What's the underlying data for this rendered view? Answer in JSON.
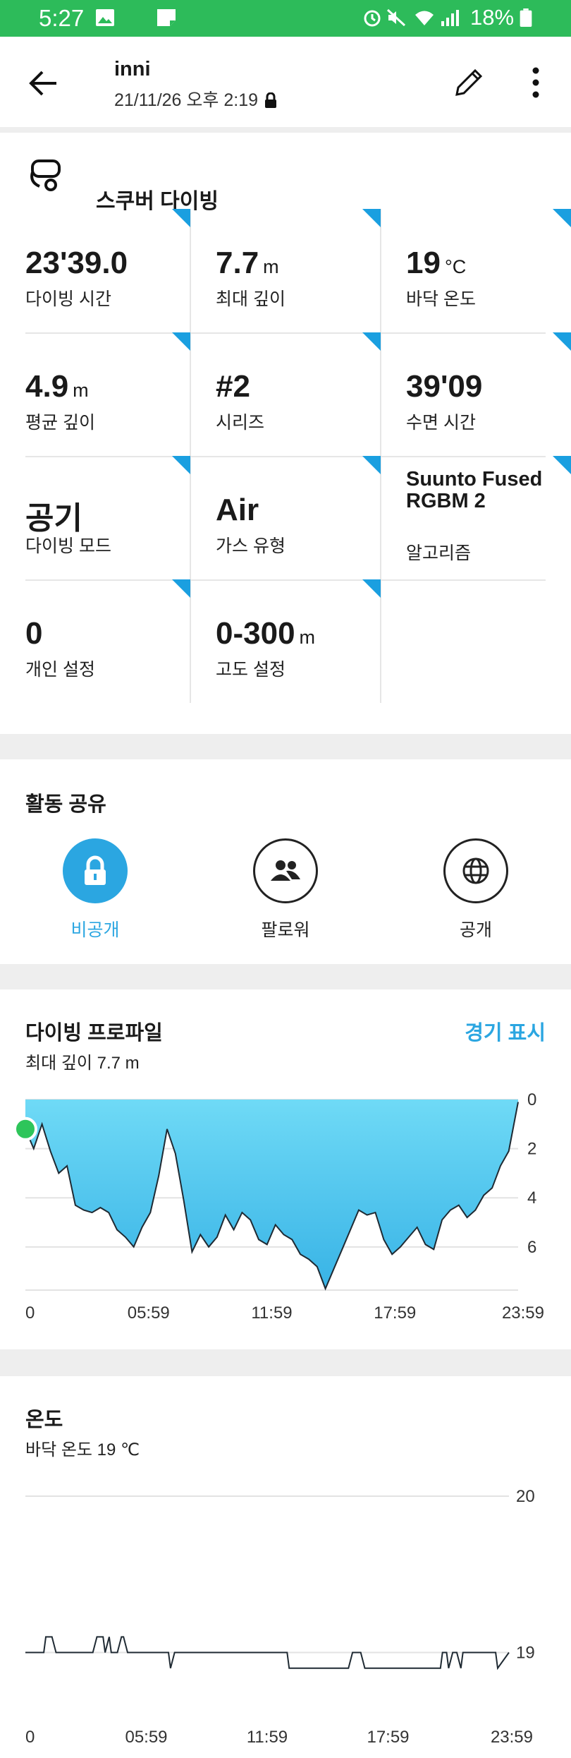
{
  "status_bar": {
    "time": "5:27",
    "battery": "18%"
  },
  "app_bar": {
    "title": "inni",
    "subtitle": "21/11/26 오후 2:19"
  },
  "dive": {
    "type_label": "스쿠버 다이빙",
    "stats": [
      {
        "value": "23'39.0",
        "unit": "",
        "label": "다이빙 시간"
      },
      {
        "value": "7.7",
        "unit": "m",
        "label": "최대 깊이"
      },
      {
        "value": "19",
        "unit": "°C",
        "label": "바닥 온도"
      },
      {
        "value": "4.9",
        "unit": "m",
        "label": "평균 깊이"
      },
      {
        "value": "#2",
        "unit": "",
        "label": "시리즈"
      },
      {
        "value": "39'09",
        "unit": "",
        "label": "수면 시간"
      },
      {
        "value": "공기",
        "unit": "",
        "label": "다이빙 모드"
      },
      {
        "value": "Air",
        "unit": "",
        "label": "가스 유형"
      },
      {
        "value": "Suunto Fused RGBM 2",
        "unit": "",
        "label": "알고리즘"
      },
      {
        "value": "0",
        "unit": "",
        "label": "개인 설정"
      },
      {
        "value": "0-300",
        "unit": "m",
        "label": "고도 설정"
      }
    ]
  },
  "share": {
    "heading": "활동 공유",
    "options": [
      {
        "label": "비공개",
        "icon": "lock-icon",
        "selected": true
      },
      {
        "label": "팔로워",
        "icon": "followers-icon",
        "selected": false
      },
      {
        "label": "공개",
        "icon": "globe-icon",
        "selected": false
      }
    ]
  },
  "profile": {
    "heading": "다이빙 프로파일",
    "link": "경기 표시",
    "subtitle": "최대 깊이 7.7 m"
  },
  "temperature": {
    "heading": "온도",
    "subtitle": "바닥 온도 19 ℃"
  },
  "colors": {
    "accent": "#2ba6e1",
    "status_bar": "#2dbb5a",
    "corner_tag": "#1a9fe0",
    "profile_fill_top": "#6fdaf6",
    "profile_fill_bottom": "#38b3e6",
    "start_marker": "#2ec55a"
  },
  "chart_data": [
    {
      "type": "area",
      "title": "다이빙 프로파일",
      "x_ticks": [
        "0",
        "05:59",
        "11:59",
        "17:59",
        "23:59"
      ],
      "y_ticks": [
        "0",
        "2",
        "4",
        "6"
      ],
      "xlim": [
        0,
        23.65
      ],
      "ylim": [
        0,
        7.7
      ],
      "y_inverted": true,
      "x": [
        0,
        0.4,
        0.8,
        1.2,
        1.6,
        2.0,
        2.4,
        2.8,
        3.2,
        3.6,
        4.0,
        4.4,
        4.8,
        5.2,
        5.6,
        6.0,
        6.4,
        6.8,
        7.2,
        7.6,
        8.0,
        8.4,
        8.8,
        9.2,
        9.6,
        10.0,
        10.4,
        10.8,
        11.2,
        11.6,
        12.0,
        12.4,
        12.8,
        13.2,
        13.6,
        14.0,
        14.4,
        14.8,
        15.2,
        15.6,
        16.0,
        16.4,
        16.8,
        17.2,
        17.6,
        18.0,
        18.4,
        18.8,
        19.2,
        19.6,
        20.0,
        20.4,
        20.8,
        21.2,
        21.6,
        22.0,
        22.4,
        22.8,
        23.2,
        23.65
      ],
      "y": [
        1.2,
        2.0,
        1.0,
        2.1,
        3.0,
        2.7,
        4.3,
        4.5,
        4.6,
        4.4,
        4.6,
        5.3,
        5.6,
        6.0,
        5.2,
        4.6,
        3.1,
        1.2,
        2.2,
        4.1,
        6.2,
        5.5,
        6.0,
        5.6,
        4.7,
        5.3,
        4.6,
        4.9,
        5.7,
        5.9,
        5.1,
        5.5,
        5.7,
        6.3,
        6.5,
        6.8,
        7.7,
        6.9,
        6.1,
        5.3,
        4.5,
        4.7,
        4.6,
        5.7,
        6.3,
        6.0,
        5.6,
        5.2,
        5.9,
        6.1,
        4.9,
        4.5,
        4.3,
        4.8,
        4.5,
        3.9,
        3.6,
        2.7,
        2.1,
        0.1
      ]
    },
    {
      "type": "line",
      "title": "온도",
      "x_ticks": [
        "0",
        "05:59",
        "11:59",
        "17:59",
        "23:59"
      ],
      "y_ticks": [
        "20",
        "19"
      ],
      "xlim": [
        0,
        23.65
      ],
      "ylim": [
        18.7,
        20
      ],
      "x": [
        0,
        0.9,
        1.0,
        1.3,
        1.5,
        3.3,
        3.5,
        3.8,
        3.9,
        4.1,
        4.2,
        4.5,
        4.7,
        4.8,
        5.0,
        7.0,
        7.1,
        7.3,
        12.8,
        12.9,
        15.8,
        16.0,
        16.4,
        16.6,
        20.3,
        20.4,
        20.6,
        20.7,
        20.9,
        21.1,
        21.3,
        21.4,
        21.6,
        23.0,
        23.1,
        23.65
      ],
      "y": [
        19.0,
        19.0,
        19.1,
        19.1,
        19.0,
        19.0,
        19.1,
        19.1,
        19.0,
        19.1,
        19.0,
        19.0,
        19.1,
        19.1,
        19.0,
        19.0,
        18.9,
        19.0,
        19.0,
        18.9,
        18.9,
        19.0,
        19.0,
        18.9,
        18.9,
        19.0,
        19.0,
        18.9,
        19.0,
        19.0,
        18.9,
        19.0,
        19.0,
        19.0,
        18.9,
        19.0
      ]
    }
  ]
}
